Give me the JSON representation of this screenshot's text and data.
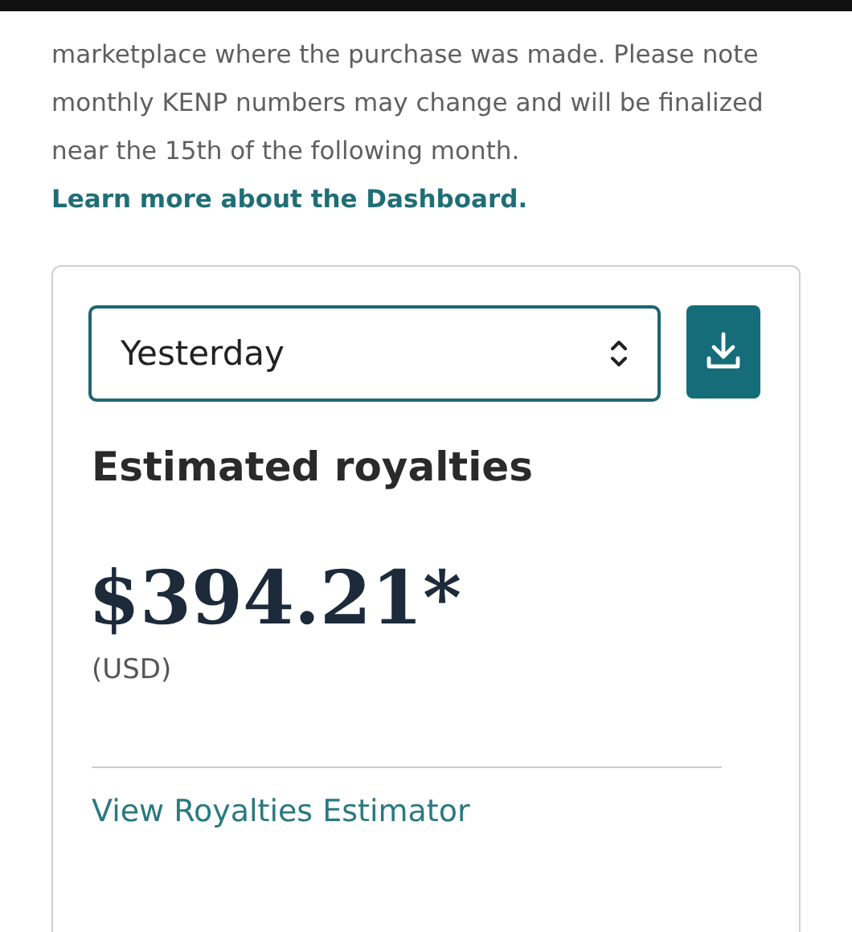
{
  "intro": {
    "text": "marketplace where the purchase was made. Please note monthly KENP numbers may change and will be finalized near the 15th of the following month.",
    "link": "Learn more about the Dashboard."
  },
  "card": {
    "period_select": {
      "value": "Yesterday"
    },
    "title": "Estimated royalties",
    "amount": "$394.21*",
    "currency": "(USD)",
    "link": "View Royalties Estimator"
  }
}
